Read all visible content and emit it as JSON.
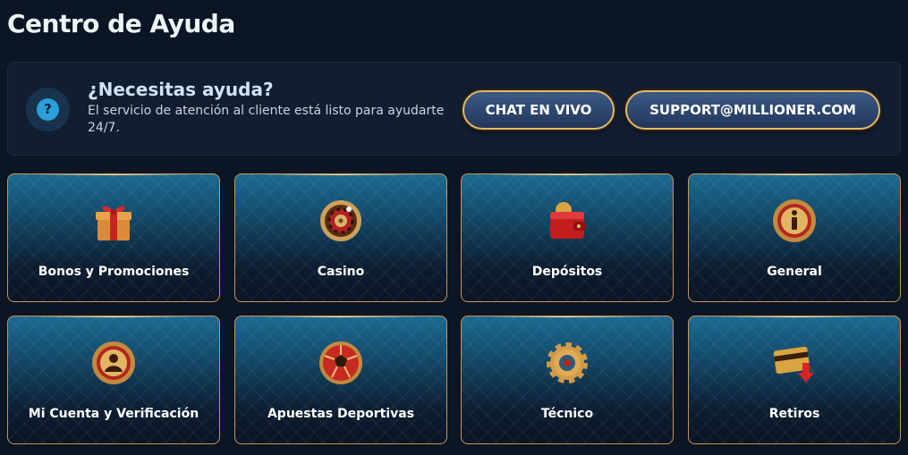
{
  "page": {
    "title": "Centro de Ayuda"
  },
  "banner": {
    "heading": "¿Necesitas ayuda?",
    "text": "El servicio de atención al cliente está listo para ayudarte 24/7.",
    "icon": "question-icon",
    "chat_label": "CHAT EN VIVO",
    "email_label": "SUPPORT@MILLIONER.COM"
  },
  "categories": [
    {
      "label": "Bonos y Promociones",
      "icon": "gift-icon"
    },
    {
      "label": "Casino",
      "icon": "roulette-icon"
    },
    {
      "label": "Depósitos",
      "icon": "wallet-icon"
    },
    {
      "label": "General",
      "icon": "info-icon"
    },
    {
      "label": "Mi Cuenta y Verificación",
      "icon": "user-icon"
    },
    {
      "label": "Apuestas Deportivas",
      "icon": "soccer-ball-icon"
    },
    {
      "label": "Técnico",
      "icon": "gear-icon"
    },
    {
      "label": "Retiros",
      "icon": "card-withdraw-icon"
    }
  ],
  "colors": {
    "background": "#0b1524",
    "accent_gold": "#c9954d",
    "button_blue": "#2f4a72",
    "card_blue": "#1c6a92"
  }
}
